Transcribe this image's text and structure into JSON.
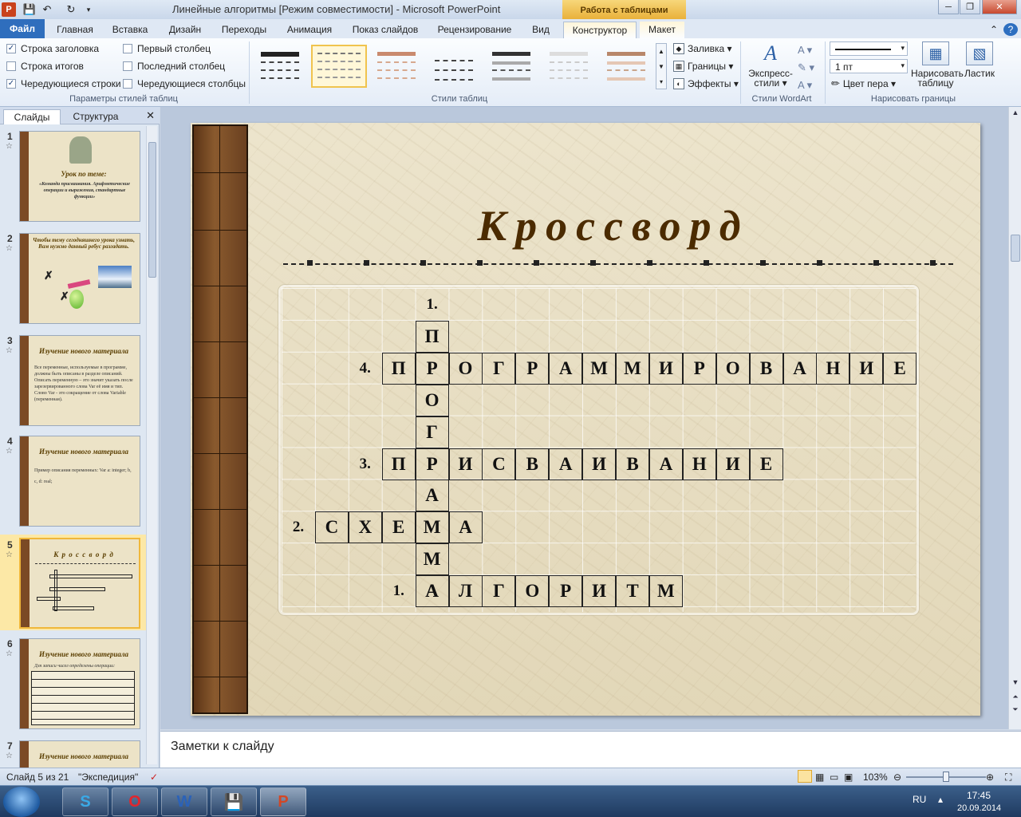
{
  "window": {
    "title": "Линейные алгоритмы [Режим совместимости]  -  Microsoft PowerPoint",
    "context_group": "Работа с таблицами",
    "app_icon": "P"
  },
  "tabs": {
    "file": "Файл",
    "items": [
      "Главная",
      "Вставка",
      "Дизайн",
      "Переходы",
      "Анимация",
      "Показ слайдов",
      "Рецензирование",
      "Вид",
      "Конструктор",
      "Макет"
    ],
    "active": "Конструктор"
  },
  "ribbon": {
    "options": {
      "header_row": "Строка заголовка",
      "total_row": "Строка итогов",
      "banded_rows": "Чередующиеся строки",
      "first_column": "Первый столбец",
      "last_column": "Последний столбец",
      "banded_columns": "Чередующиеся столбцы",
      "group_title": "Параметры стилей таблиц",
      "checked": {
        "header_row": true,
        "total_row": false,
        "banded_rows": true,
        "first_column": false,
        "last_column": false,
        "banded_columns": false
      }
    },
    "styles": {
      "group_title": "Стили таблиц"
    },
    "fill": "Заливка",
    "borders": "Границы",
    "effects": "Эффекты",
    "wordart": {
      "label1": "Экспресс-",
      "label2": "стили",
      "group_title": "Стили WordArt"
    },
    "draw": {
      "pen_weight": "1 пт",
      "pen_color": "Цвет пера",
      "draw_table1": "Нарисовать",
      "draw_table2": "таблицу",
      "eraser": "Ластик",
      "group_title": "Нарисовать границы"
    }
  },
  "panel": {
    "tab_slides": "Слайды",
    "tab_outline": "Структура",
    "thumbs": [
      {
        "num": "1",
        "title": "Урок по теме:",
        "text": "«Команда присваивания. Арифметические операции и выражения, стандартные функции»"
      },
      {
        "num": "2",
        "title": "Чтобы тему сегодняшнего урока узнать, Вам нужно данный ребус разгадать.",
        "text": ""
      },
      {
        "num": "3",
        "title": "Изучение нового материала",
        "text": "Все переменные, используемые в программе, должны быть описаны в разделе описаний. Описать переменную – это значит указать после зарезервированного слова Var её имя и тип. Слово Var - это сокращение от слова Variable (переменная)."
      },
      {
        "num": "4",
        "title": "Изучение нового материала",
        "text": "Пример описания переменных: Var a: integer; b, c, d: real;"
      },
      {
        "num": "5",
        "title": "К р о с с в о р д",
        "text": ""
      },
      {
        "num": "6",
        "title": "Изучение нового материала",
        "text": "Для записи чисел определены операции:"
      },
      {
        "num": "7",
        "title": "Изучение нового материала",
        "text": ""
      }
    ]
  },
  "slide": {
    "title": "Кроссворд",
    "crossword": {
      "vertical": [
        "П",
        "Р",
        "О",
        "Г",
        "Р",
        "А",
        "М",
        "М",
        "А"
      ],
      "h4": [
        "П",
        "Р",
        "О",
        "Г",
        "Р",
        "А",
        "М",
        "М",
        "И",
        "Р",
        "О",
        "В",
        "А",
        "Н",
        "И",
        "Е"
      ],
      "h3": [
        "П",
        "Р",
        "И",
        "С",
        "В",
        "А",
        "И",
        "В",
        "А",
        "Н",
        "И",
        "Е"
      ],
      "h2": [
        "С",
        "Х",
        "Е",
        "М",
        "А"
      ],
      "h1": [
        "А",
        "Л",
        "Г",
        "О",
        "Р",
        "И",
        "Т",
        "М"
      ],
      "num_v": "1.",
      "num_4": "4.",
      "num_3": "3.",
      "num_2": "2.",
      "num_1": "1."
    }
  },
  "notes": {
    "placeholder": "Заметки к слайду"
  },
  "status": {
    "slide_pos": "Слайд 5 из 21",
    "theme": "\"Экспедиция\"",
    "zoom": "103%"
  },
  "tray": {
    "lang": "RU",
    "time": "17:45",
    "date": "20.09.2014"
  }
}
